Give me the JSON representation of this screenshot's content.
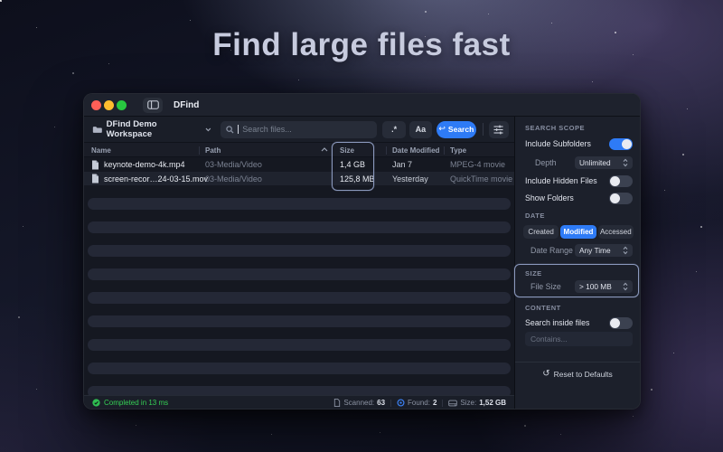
{
  "hero": {
    "title": "Find large files fast"
  },
  "window": {
    "titlebar": {
      "app_name": "DFind"
    },
    "toolbar": {
      "workspace_label": "DFind Demo Workspace",
      "search_placeholder": "Search files...",
      "regex_label": ".*",
      "case_label": "Aa",
      "search_label": "Search"
    },
    "table": {
      "header": {
        "name": "Name",
        "path": "Path",
        "size": "Size",
        "date_modified": "Date Modified",
        "type": "Type"
      },
      "rows": [
        {
          "name": "keynote-demo-4k.mp4",
          "path": "03-Media/Video",
          "size": "1,4 GB",
          "date_modified": "Jan 7",
          "type": "MPEG-4 movie"
        },
        {
          "name": "screen-recor…24-03-15.mov",
          "path": "03-Media/Video",
          "size": "125,8 MB",
          "date_modified": "Yesterday",
          "type": "QuickTime movie"
        }
      ]
    },
    "status": {
      "completed": "Completed in 13 ms",
      "scanned_label": "Scanned:",
      "scanned_value": "63",
      "found_label": "Found:",
      "found_value": "2",
      "size_label": "Size:",
      "size_value": "1,52 GB"
    }
  },
  "panel": {
    "scope": {
      "section_label": "SEARCH SCOPE",
      "include_subfolders": "Include Subfolders",
      "include_subfolders_state": "on",
      "depth_label": "Depth",
      "depth_value": "Unlimited",
      "include_hidden": "Include Hidden Files",
      "include_hidden_state": "off",
      "show_folders": "Show Folders",
      "show_folders_state": "off"
    },
    "date": {
      "section_label": "DATE",
      "created": "Created",
      "modified": "Modified",
      "accessed": "Accessed",
      "selected": "Modified",
      "range_label": "Date Range",
      "range_value": "Any Time"
    },
    "size": {
      "section_label": "SIZE",
      "file_size_label": "File Size",
      "file_size_value": "> 100 MB"
    },
    "content": {
      "section_label": "CONTENT",
      "search_inside": "Search inside files",
      "search_inside_state": "off",
      "contains_placeholder": "Contains..."
    },
    "reset_label": "Reset to Defaults"
  },
  "colors": {
    "accent_blue": "#2e7bf6",
    "highlight_border": "#8b99bd",
    "success_green": "#35d054",
    "window_bg": "#161a24",
    "panel_bg": "#1c202b"
  }
}
